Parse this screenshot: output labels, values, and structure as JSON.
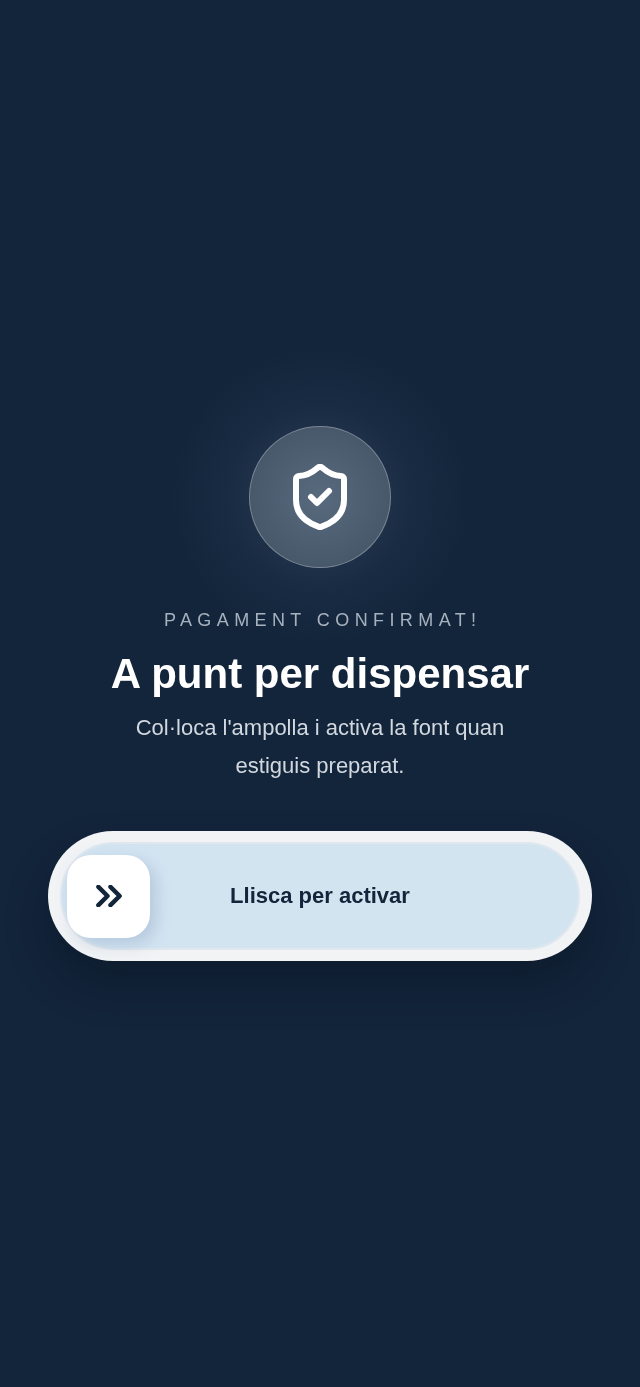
{
  "confirmation": {
    "eyebrow": "PAGAMENT CONFIRMAT!",
    "title": "A punt per dispensar",
    "message": "Col·loca l'ampolla i activa la font quan estiguis preparat."
  },
  "swipe_slider": {
    "label": "Llisca per activar",
    "level": 0
  }
}
